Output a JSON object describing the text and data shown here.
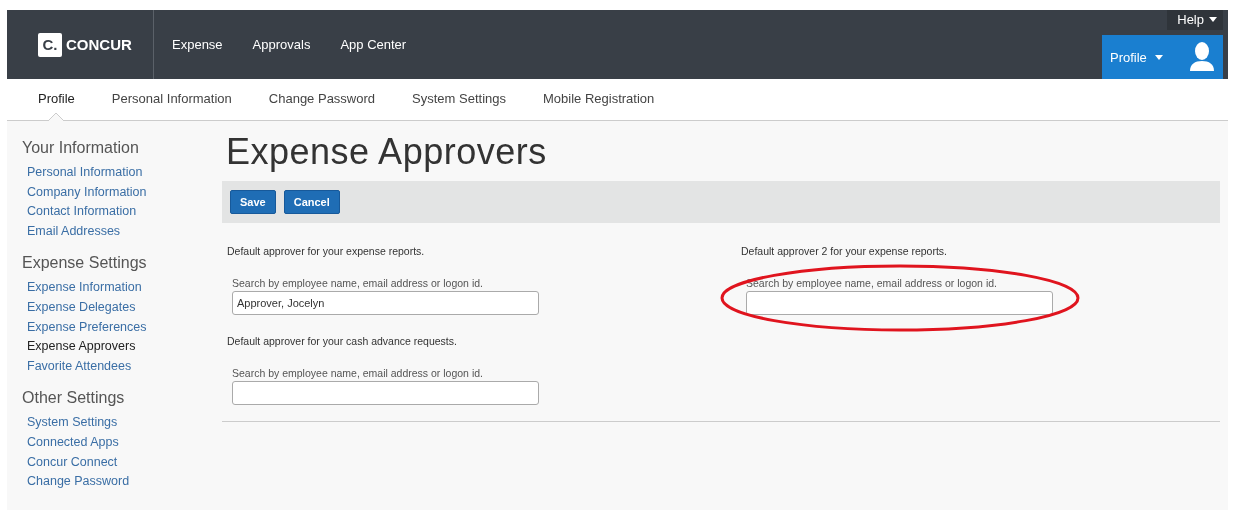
{
  "header": {
    "logo_mark": "C.",
    "logo_text": "CONCUR",
    "nav": [
      {
        "label": "Expense"
      },
      {
        "label": "Approvals"
      },
      {
        "label": "App Center"
      }
    ],
    "help": "Help",
    "profile_button": "Profile"
  },
  "subnav": [
    {
      "label": "Profile",
      "selected": true
    },
    {
      "label": "Personal Information",
      "selected": false
    },
    {
      "label": "Change Password",
      "selected": false
    },
    {
      "label": "System Settings",
      "selected": false
    },
    {
      "label": "Mobile Registration",
      "selected": false
    }
  ],
  "sidebar": [
    {
      "heading": "Your Information",
      "items": [
        {
          "label": "Personal Information",
          "selected": false
        },
        {
          "label": "Company Information",
          "selected": false
        },
        {
          "label": "Contact Information",
          "selected": false
        },
        {
          "label": "Email Addresses",
          "selected": false
        }
      ]
    },
    {
      "heading": "Expense Settings",
      "items": [
        {
          "label": "Expense Information",
          "selected": false
        },
        {
          "label": "Expense Delegates",
          "selected": false
        },
        {
          "label": "Expense Preferences",
          "selected": false
        },
        {
          "label": "Expense Approvers",
          "selected": true
        },
        {
          "label": "Favorite Attendees",
          "selected": false
        }
      ]
    },
    {
      "heading": "Other Settings",
      "items": [
        {
          "label": "System Settings",
          "selected": false
        },
        {
          "label": "Connected Apps",
          "selected": false
        },
        {
          "label": "Concur Connect",
          "selected": false
        },
        {
          "label": "Change Password",
          "selected": false
        }
      ]
    }
  ],
  "page_title": "Expense Approvers",
  "toolbar": [
    "Save",
    "Cancel"
  ],
  "columns": [
    [
      {
        "label": "Default approver for your expense reports.",
        "hint": "Search by employee name, email address or logon id.",
        "value": "Approver, Jocelyn",
        "highlighted": false
      },
      {
        "label": "Default approver for your cash advance requests.",
        "hint": "Search by employee name, email address or logon id.",
        "highlighted": false
      }
    ],
    [
      {
        "label": "Default approver 2 for your expense reports.",
        "hint": "Search by employee name, email address or logon id.",
        "highlighted": true
      }
    ]
  ]
}
